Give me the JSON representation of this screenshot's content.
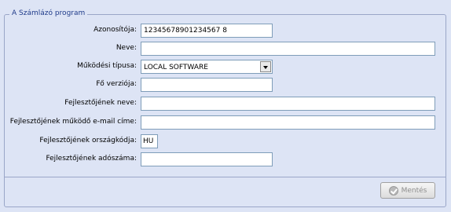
{
  "group": {
    "title": "A Számlázó program"
  },
  "form": {
    "id": {
      "label": "Azonosítója:",
      "value": "12345678901234567 8"
    },
    "name": {
      "label": "Neve:",
      "value": ""
    },
    "mode": {
      "label": "Működési típusa:",
      "value": "LOCAL SOFTWARE"
    },
    "version": {
      "label": "Fő verziója:",
      "value": ""
    },
    "dev_name": {
      "label": "Fejlesztőjének neve:",
      "value": ""
    },
    "dev_email": {
      "label": "Fejlesztőjének működő e-mail címe:",
      "value": ""
    },
    "dev_country": {
      "label": "Fejlesztőjének országkódja:",
      "value": "HU"
    },
    "dev_tax": {
      "label": "Fejlesztőjének adószáma:",
      "value": ""
    }
  },
  "actions": {
    "save_label": "Mentés"
  },
  "colors": {
    "background": "#dde4f5",
    "border": "#9aa6c8",
    "title": "#1f3b8a",
    "disabled_text": "#8e8e8e"
  }
}
